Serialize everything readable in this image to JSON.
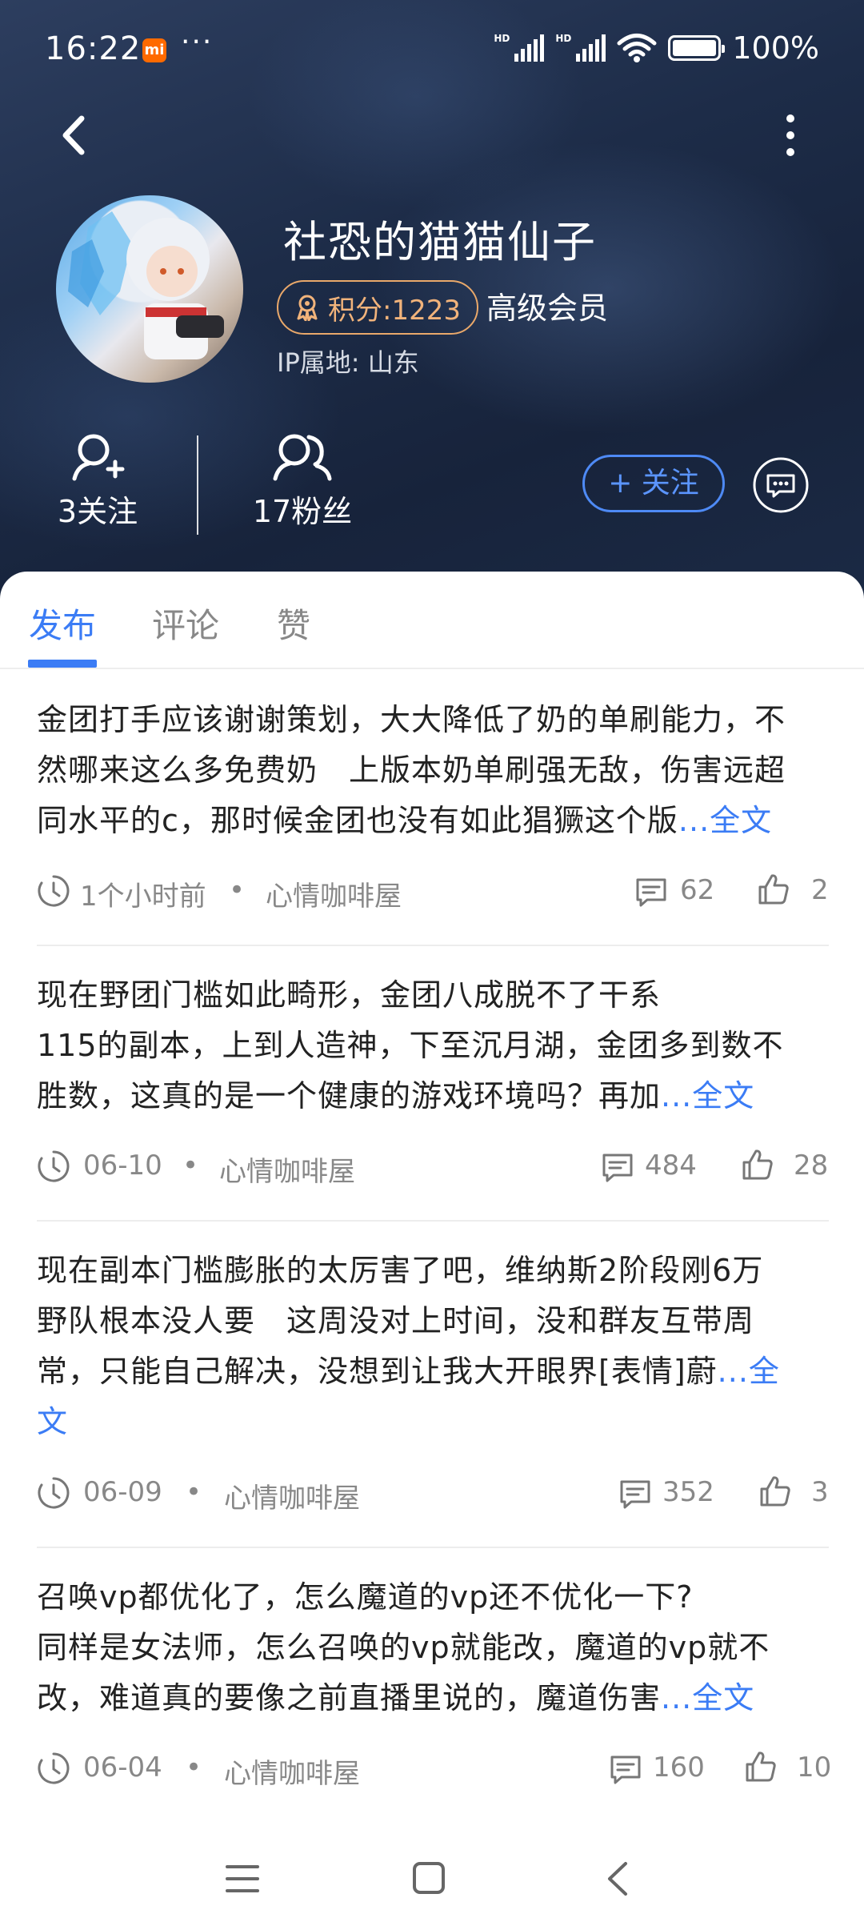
{
  "status_bar": {
    "time": "16:22",
    "app_badge": "mi",
    "more": "···",
    "battery": "100%"
  },
  "profile": {
    "name": "社恐的猫猫仙子",
    "points": "积分:1223",
    "member_level": "高级会员",
    "ip_location": "IP属地: 山东",
    "following": "3关注",
    "followers": "17粉丝",
    "follow_button": "+ 关注"
  },
  "tabs": [
    "发布",
    "评论",
    "赞"
  ],
  "posts": [
    {
      "lines": [
        "金团打手应该谢谢策划，大大降低了奶的单刷能力，不",
        "然哪来这么多免费奶　上版本奶单刷强无敌，伤害远超",
        "同水平的c，那时候金团也没有如此猖獗这个版"
      ],
      "more": "...全文",
      "time": "1个小时前",
      "category": "心情咖啡屋",
      "comments": "62",
      "likes": "2"
    },
    {
      "lines": [
        "现在野团门槛如此畸形，金团八成脱不了干系",
        "115的副本，上到人造神，下至沉月湖，金团多到数不",
        "胜数，这真的是一个健康的游戏环境吗？再加"
      ],
      "more": "...全文",
      "time": "06-10",
      "category": "心情咖啡屋",
      "comments": "484",
      "likes": "28"
    },
    {
      "lines": [
        "现在副本门槛膨胀的太厉害了吧，维纳斯2阶段刚6万",
        "野队根本没人要　这周没对上时间，没和群友互带周",
        "常，只能自己解决，没想到让我大开眼界[表情]蔚"
      ],
      "more": "...全",
      "more2": "文",
      "time": "06-09",
      "category": "心情咖啡屋",
      "comments": "352",
      "likes": "3"
    },
    {
      "lines": [
        "召唤vp都优化了，怎么魔道的vp还不优化一下?",
        "同样是女法师，怎么召唤的vp就能改，魔道的vp就不",
        "改，难道真的要像之前直播里说的，魔道伤害"
      ],
      "more": "...全文",
      "time": "06-04",
      "category": "心情咖啡屋",
      "comments": "160",
      "likes": "10"
    }
  ],
  "colors": {
    "accent": "#3b7cf5",
    "points": "#f1b37b",
    "header_bg": "#1d2c48"
  },
  "icons": [
    "back-arrow-icon",
    "more-vertical-icon",
    "add-user-icon",
    "users-icon",
    "message-icon",
    "clock-icon",
    "comment-icon",
    "thumbs-up-icon",
    "menu-icon",
    "home-square-icon",
    "nav-back-icon"
  ]
}
